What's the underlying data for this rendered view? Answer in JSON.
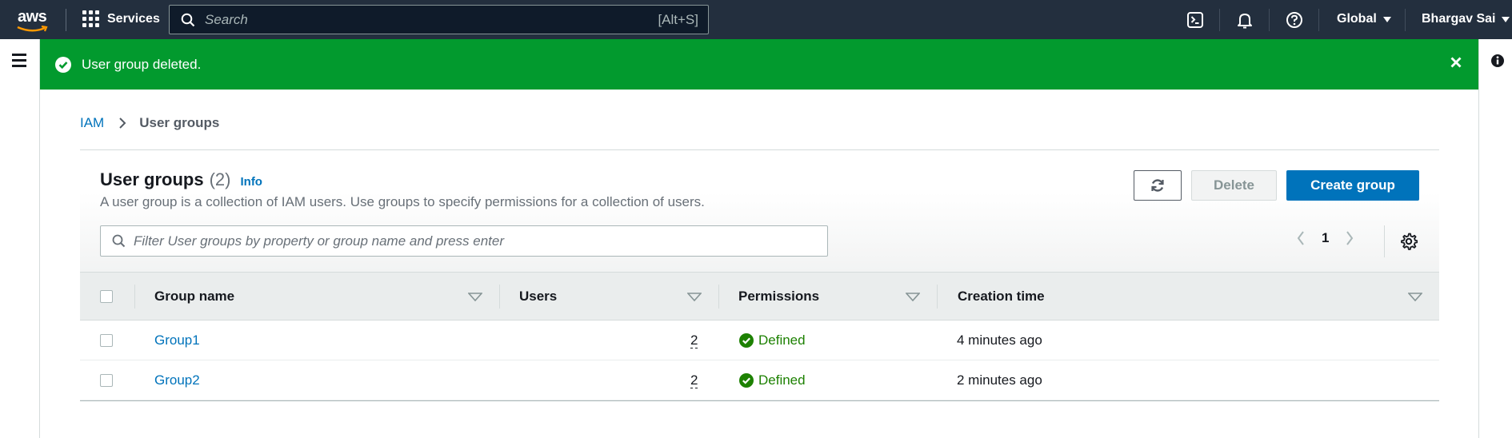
{
  "nav": {
    "logo": "aws",
    "services": "Services",
    "search_placeholder": "Search",
    "search_shortcut": "[Alt+S]",
    "region": "Global",
    "user": "Bhargav Sai"
  },
  "flash": {
    "message": "User group deleted.",
    "status_color": "#029a2e"
  },
  "breadcrumb": {
    "items": [
      "IAM",
      "User groups"
    ]
  },
  "panel": {
    "title": "User groups",
    "count": "(2)",
    "info": "Info",
    "description": "A user group is a collection of IAM users. Use groups to specify permissions for a collection of users.",
    "delete_label": "Delete",
    "create_label": "Create group",
    "filter_placeholder": "Filter User groups by property or group name and press enter",
    "page": "1"
  },
  "table": {
    "columns": [
      "Group name",
      "Users",
      "Permissions",
      "Creation time"
    ],
    "rows": [
      {
        "name": "Group1",
        "users": "2",
        "permissions": "Defined",
        "created": "4 minutes ago"
      },
      {
        "name": "Group2",
        "users": "2",
        "permissions": "Defined",
        "created": "2 minutes ago"
      }
    ]
  },
  "colors": {
    "nav_bg": "#232f3e",
    "accent": "#0073bb",
    "success": "#1d8102"
  }
}
